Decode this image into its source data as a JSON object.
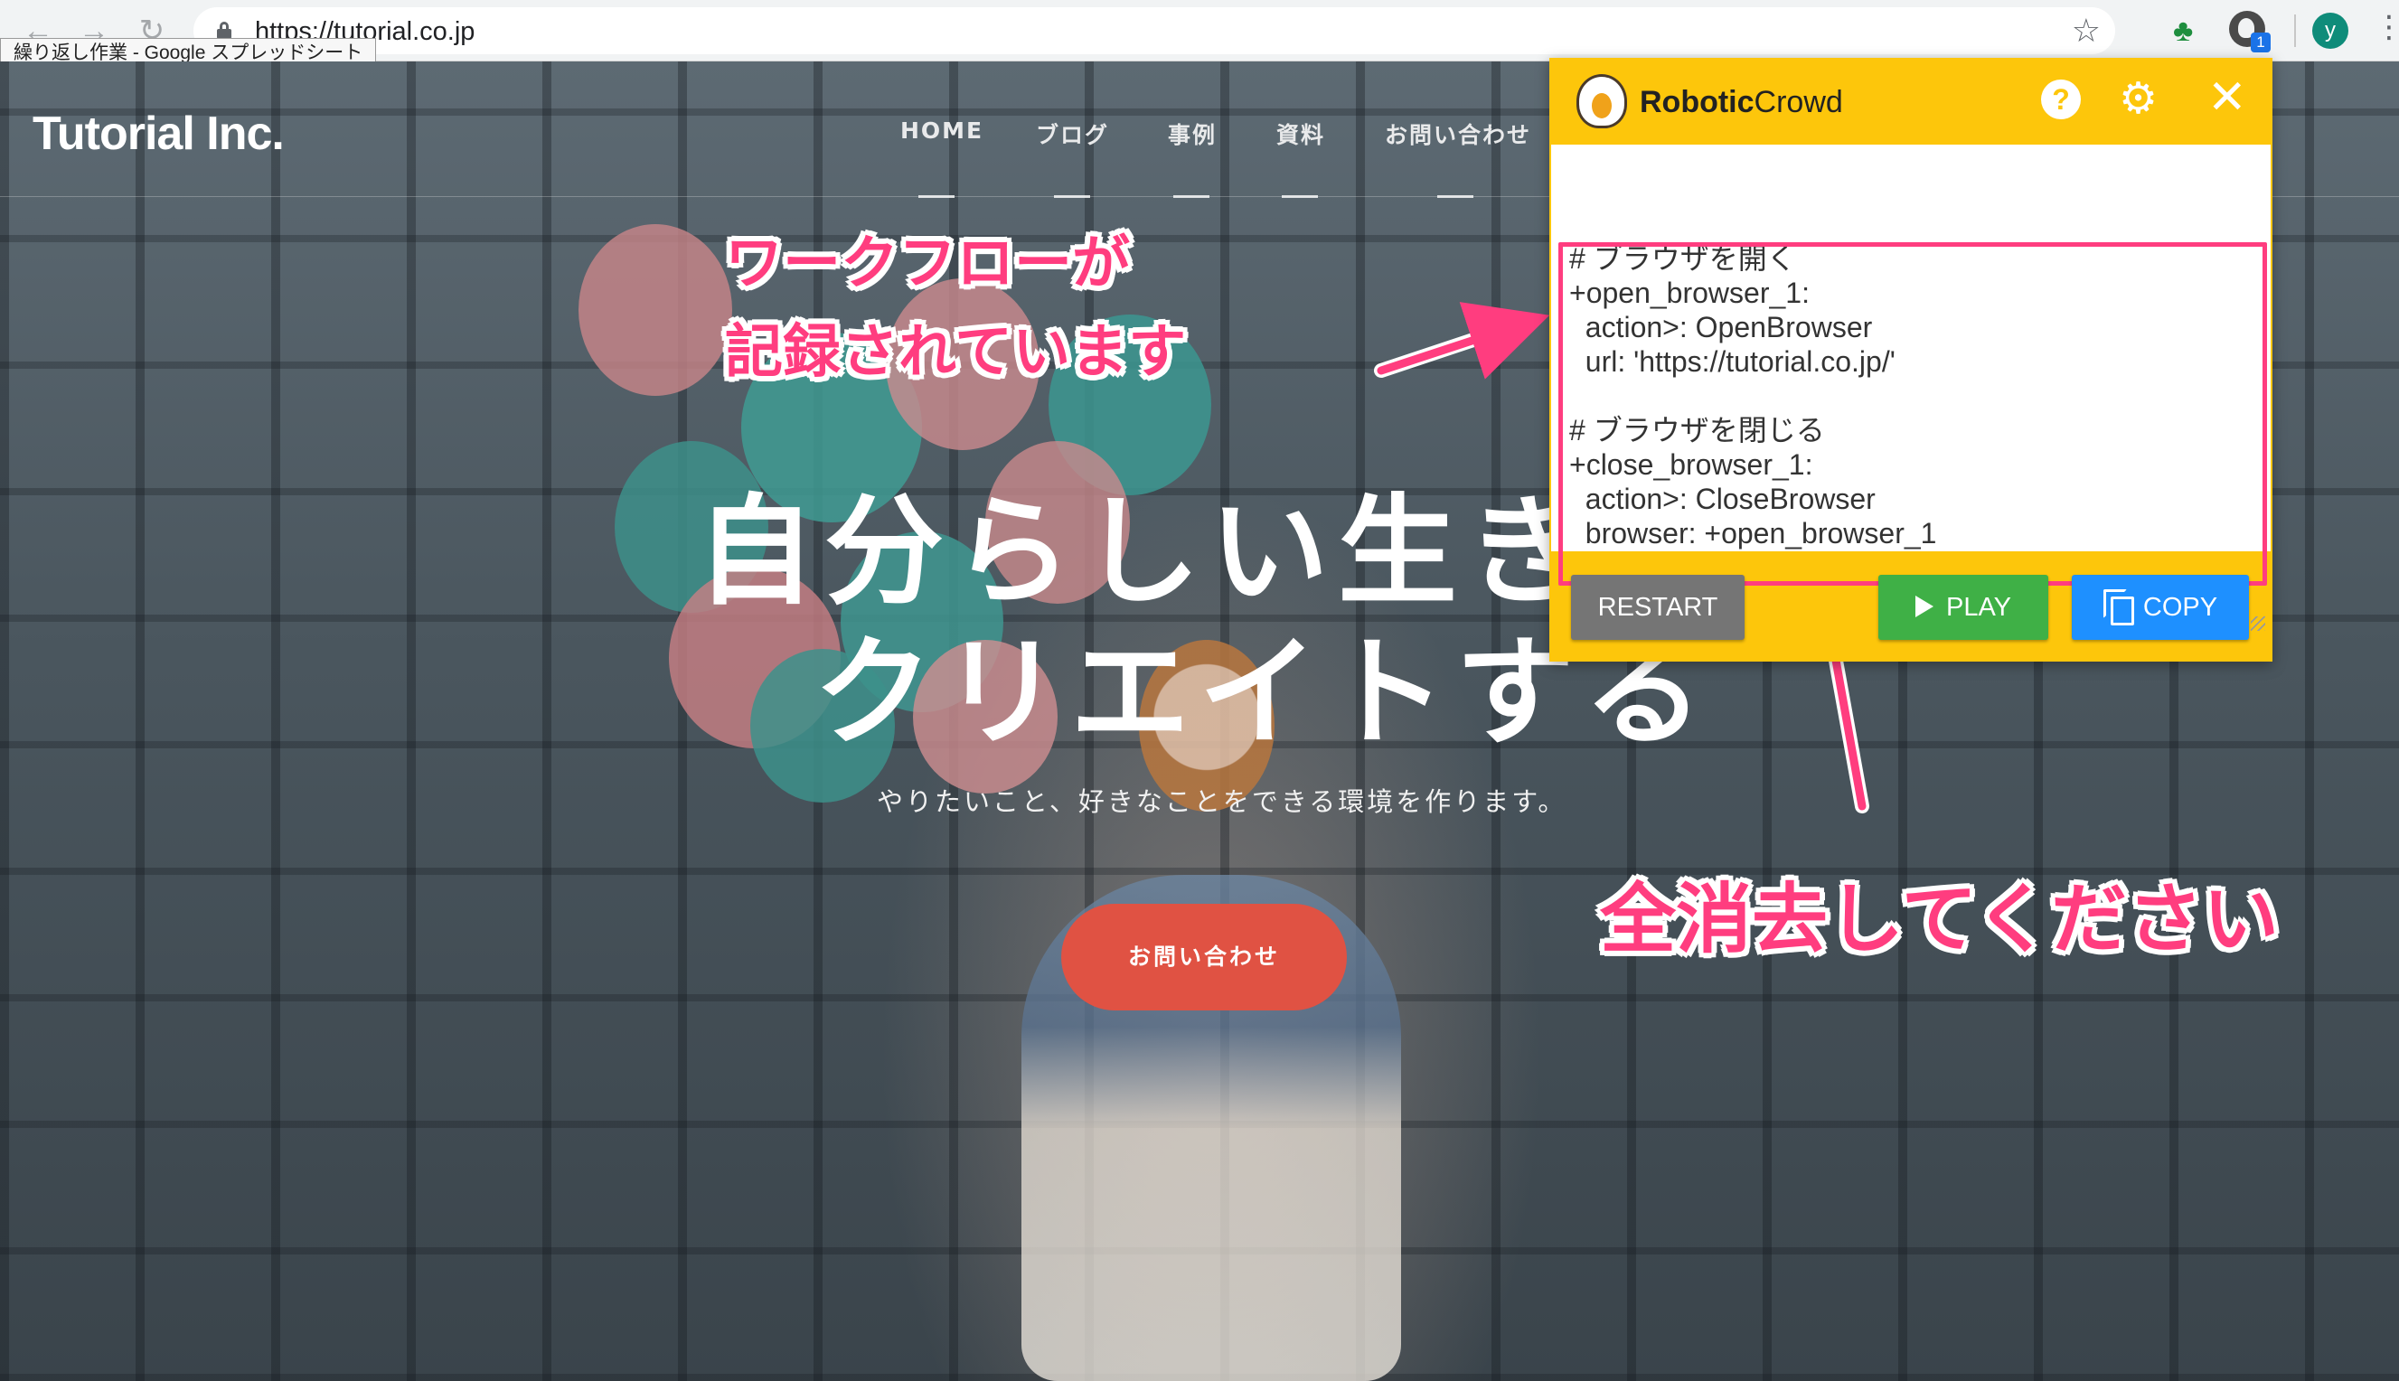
{
  "browser": {
    "url": "https://tutorial.co.jp",
    "tooltip": "繰り返し作業 - Google スプレッドシート",
    "back_icon": "←",
    "forward_icon": "→",
    "reload_icon": "↻",
    "star_icon": "☆",
    "extension_badge": "1",
    "profile_initial": "y",
    "menu_icon": "⋮"
  },
  "site": {
    "logo": "Tutorial Inc.",
    "nav": [
      "HOME",
      "ブログ",
      "事例",
      "資料",
      "お問い合わせ"
    ],
    "hero_line1": "自分らしい生き方",
    "hero_line2": "クリエイトする",
    "hero_sub": "やりたいこと、好きなことをできる環境を作ります。",
    "cta": "お問い合わせ"
  },
  "annotations": {
    "line1": "ワークフローが",
    "line2": "記録されています",
    "clear": "全消去してください",
    "color": "#ff3d7f"
  },
  "extension": {
    "brand_bold": "Robotic",
    "brand_rest": "Crowd",
    "help_icon": "?",
    "gear_icon": "⚙",
    "close_icon": "✕",
    "code_lines": [
      "# ブラウザを開く",
      "+open_browser_1:",
      "  action>: OpenBrowser",
      "  url: 'https://tutorial.co.jp/'",
      "",
      "# ブラウザを閉じる",
      "+close_browser_1:",
      "  action>: CloseBrowser",
      "  browser: +open_browser_1"
    ],
    "restart_label": "RESTART",
    "play_label": "PLAY",
    "copy_label": "COPY",
    "accent": "#fdc60b"
  }
}
